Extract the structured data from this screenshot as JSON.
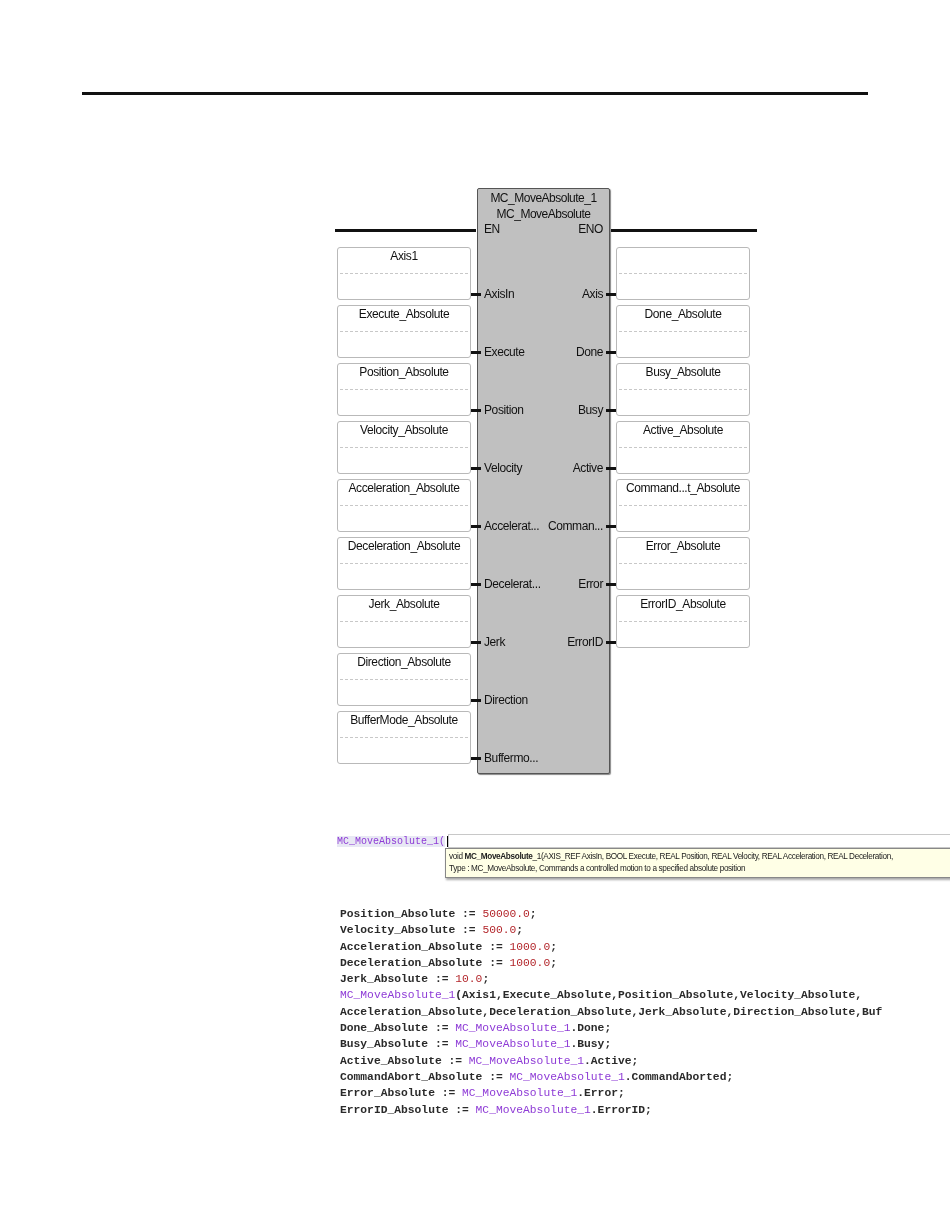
{
  "function_block": {
    "instance": "MC_MoveAbsolute_1",
    "type": "MC_MoveAbsolute",
    "en_pin": "EN",
    "eno_pin": "ENO",
    "inputs": [
      {
        "variable": "Axis1",
        "pin": "AxisIn"
      },
      {
        "variable": "Execute_Absolute",
        "pin": "Execute"
      },
      {
        "variable": "Position_Absolute",
        "pin": "Position"
      },
      {
        "variable": "Velocity_Absolute",
        "pin": "Velocity"
      },
      {
        "variable": "Acceleration_Absolute",
        "pin": "Accelerat..."
      },
      {
        "variable": "Deceleration_Absolute",
        "pin": "Decelerat..."
      },
      {
        "variable": "Jerk_Absolute",
        "pin": "Jerk"
      },
      {
        "variable": "Direction_Absolute",
        "pin": "Direction"
      },
      {
        "variable": "BufferMode_Absolute",
        "pin": "Buffermo..."
      }
    ],
    "outputs": [
      {
        "pin": "Axis"
      },
      {
        "variable": "Done_Absolute",
        "pin": "Done"
      },
      {
        "variable": "Busy_Absolute",
        "pin": "Busy"
      },
      {
        "variable": "Active_Absolute",
        "pin": "Active"
      },
      {
        "variable": "Command...t_Absolute",
        "pin": "Comman..."
      },
      {
        "variable": "Error_Absolute",
        "pin": "Error"
      },
      {
        "variable": "ErrorID_Absolute",
        "pin": "ErrorID"
      }
    ]
  },
  "code_editor": {
    "input": "MC_MoveAbsolute_1(",
    "tooltip": [
      "void **MC_MoveAbsolute**_1(AXIS_REF AxisIn, BOOL Execute, REAL Position, REAL Velocity, REAL Acceleration, REAL Deceleration,",
      "Type : MC_MoveAbsolute, Commands a controlled motion to a specified absolute position"
    ],
    "lines": [
      [
        {
          "kind": "text",
          "text": "Position_Absolute := "
        },
        {
          "kind": "number",
          "text": "50000.0"
        },
        {
          "kind": "text",
          "text": ";"
        }
      ],
      [
        {
          "kind": "text",
          "text": "Velocity_Absolute := "
        },
        {
          "kind": "number",
          "text": "500.0"
        },
        {
          "kind": "text",
          "text": ";"
        }
      ],
      [
        {
          "kind": "text",
          "text": "Acceleration_Absolute := "
        },
        {
          "kind": "number",
          "text": "1000.0"
        },
        {
          "kind": "text",
          "text": ";"
        }
      ],
      [
        {
          "kind": "text",
          "text": "Deceleration_Absolute := "
        },
        {
          "kind": "number",
          "text": "1000.0"
        },
        {
          "kind": "text",
          "text": ";"
        }
      ],
      [
        {
          "kind": "text",
          "text": "Jerk_Absolute := "
        },
        {
          "kind": "number",
          "text": "10.0"
        },
        {
          "kind": "text",
          "text": ";"
        }
      ],
      [
        {
          "kind": "instance",
          "text": "MC_MoveAbsolute_1"
        },
        {
          "kind": "text",
          "text": "(Axis1,Execute_Absolute,Position_Absolute,Velocity_Absolute,"
        }
      ],
      [
        {
          "kind": "text",
          "text": "Acceleration_Absolute,Deceleration_Absolute,Jerk_Absolute,Direction_Absolute,Buf"
        }
      ],
      [
        {
          "kind": "text",
          "text": "Done_Absolute := "
        },
        {
          "kind": "instance",
          "text": "MC_MoveAbsolute_1"
        },
        {
          "kind": "text",
          "text": ".Done;"
        }
      ],
      [
        {
          "kind": "text",
          "text": "Busy_Absolute := "
        },
        {
          "kind": "instance",
          "text": "MC_MoveAbsolute_1"
        },
        {
          "kind": "text",
          "text": ".Busy;"
        }
      ],
      [
        {
          "kind": "text",
          "text": "Active_Absolute := "
        },
        {
          "kind": "instance",
          "text": "MC_MoveAbsolute_1"
        },
        {
          "kind": "text",
          "text": ".Active;"
        }
      ],
      [
        {
          "kind": "text",
          "text": "CommandAbort_Absolute := "
        },
        {
          "kind": "instance",
          "text": "MC_MoveAbsolute_1"
        },
        {
          "kind": "text",
          "text": ".CommandAborted;"
        }
      ],
      [
        {
          "kind": "text",
          "text": "Error_Absolute := "
        },
        {
          "kind": "instance",
          "text": "MC_MoveAbsolute_1"
        },
        {
          "kind": "text",
          "text": ".Error;"
        }
      ],
      [
        {
          "kind": "text",
          "text": "ErrorID_Absolute := "
        },
        {
          "kind": "instance",
          "text": "MC_MoveAbsolute_1"
        },
        {
          "kind": "text",
          "text": ".ErrorID;"
        }
      ]
    ]
  }
}
